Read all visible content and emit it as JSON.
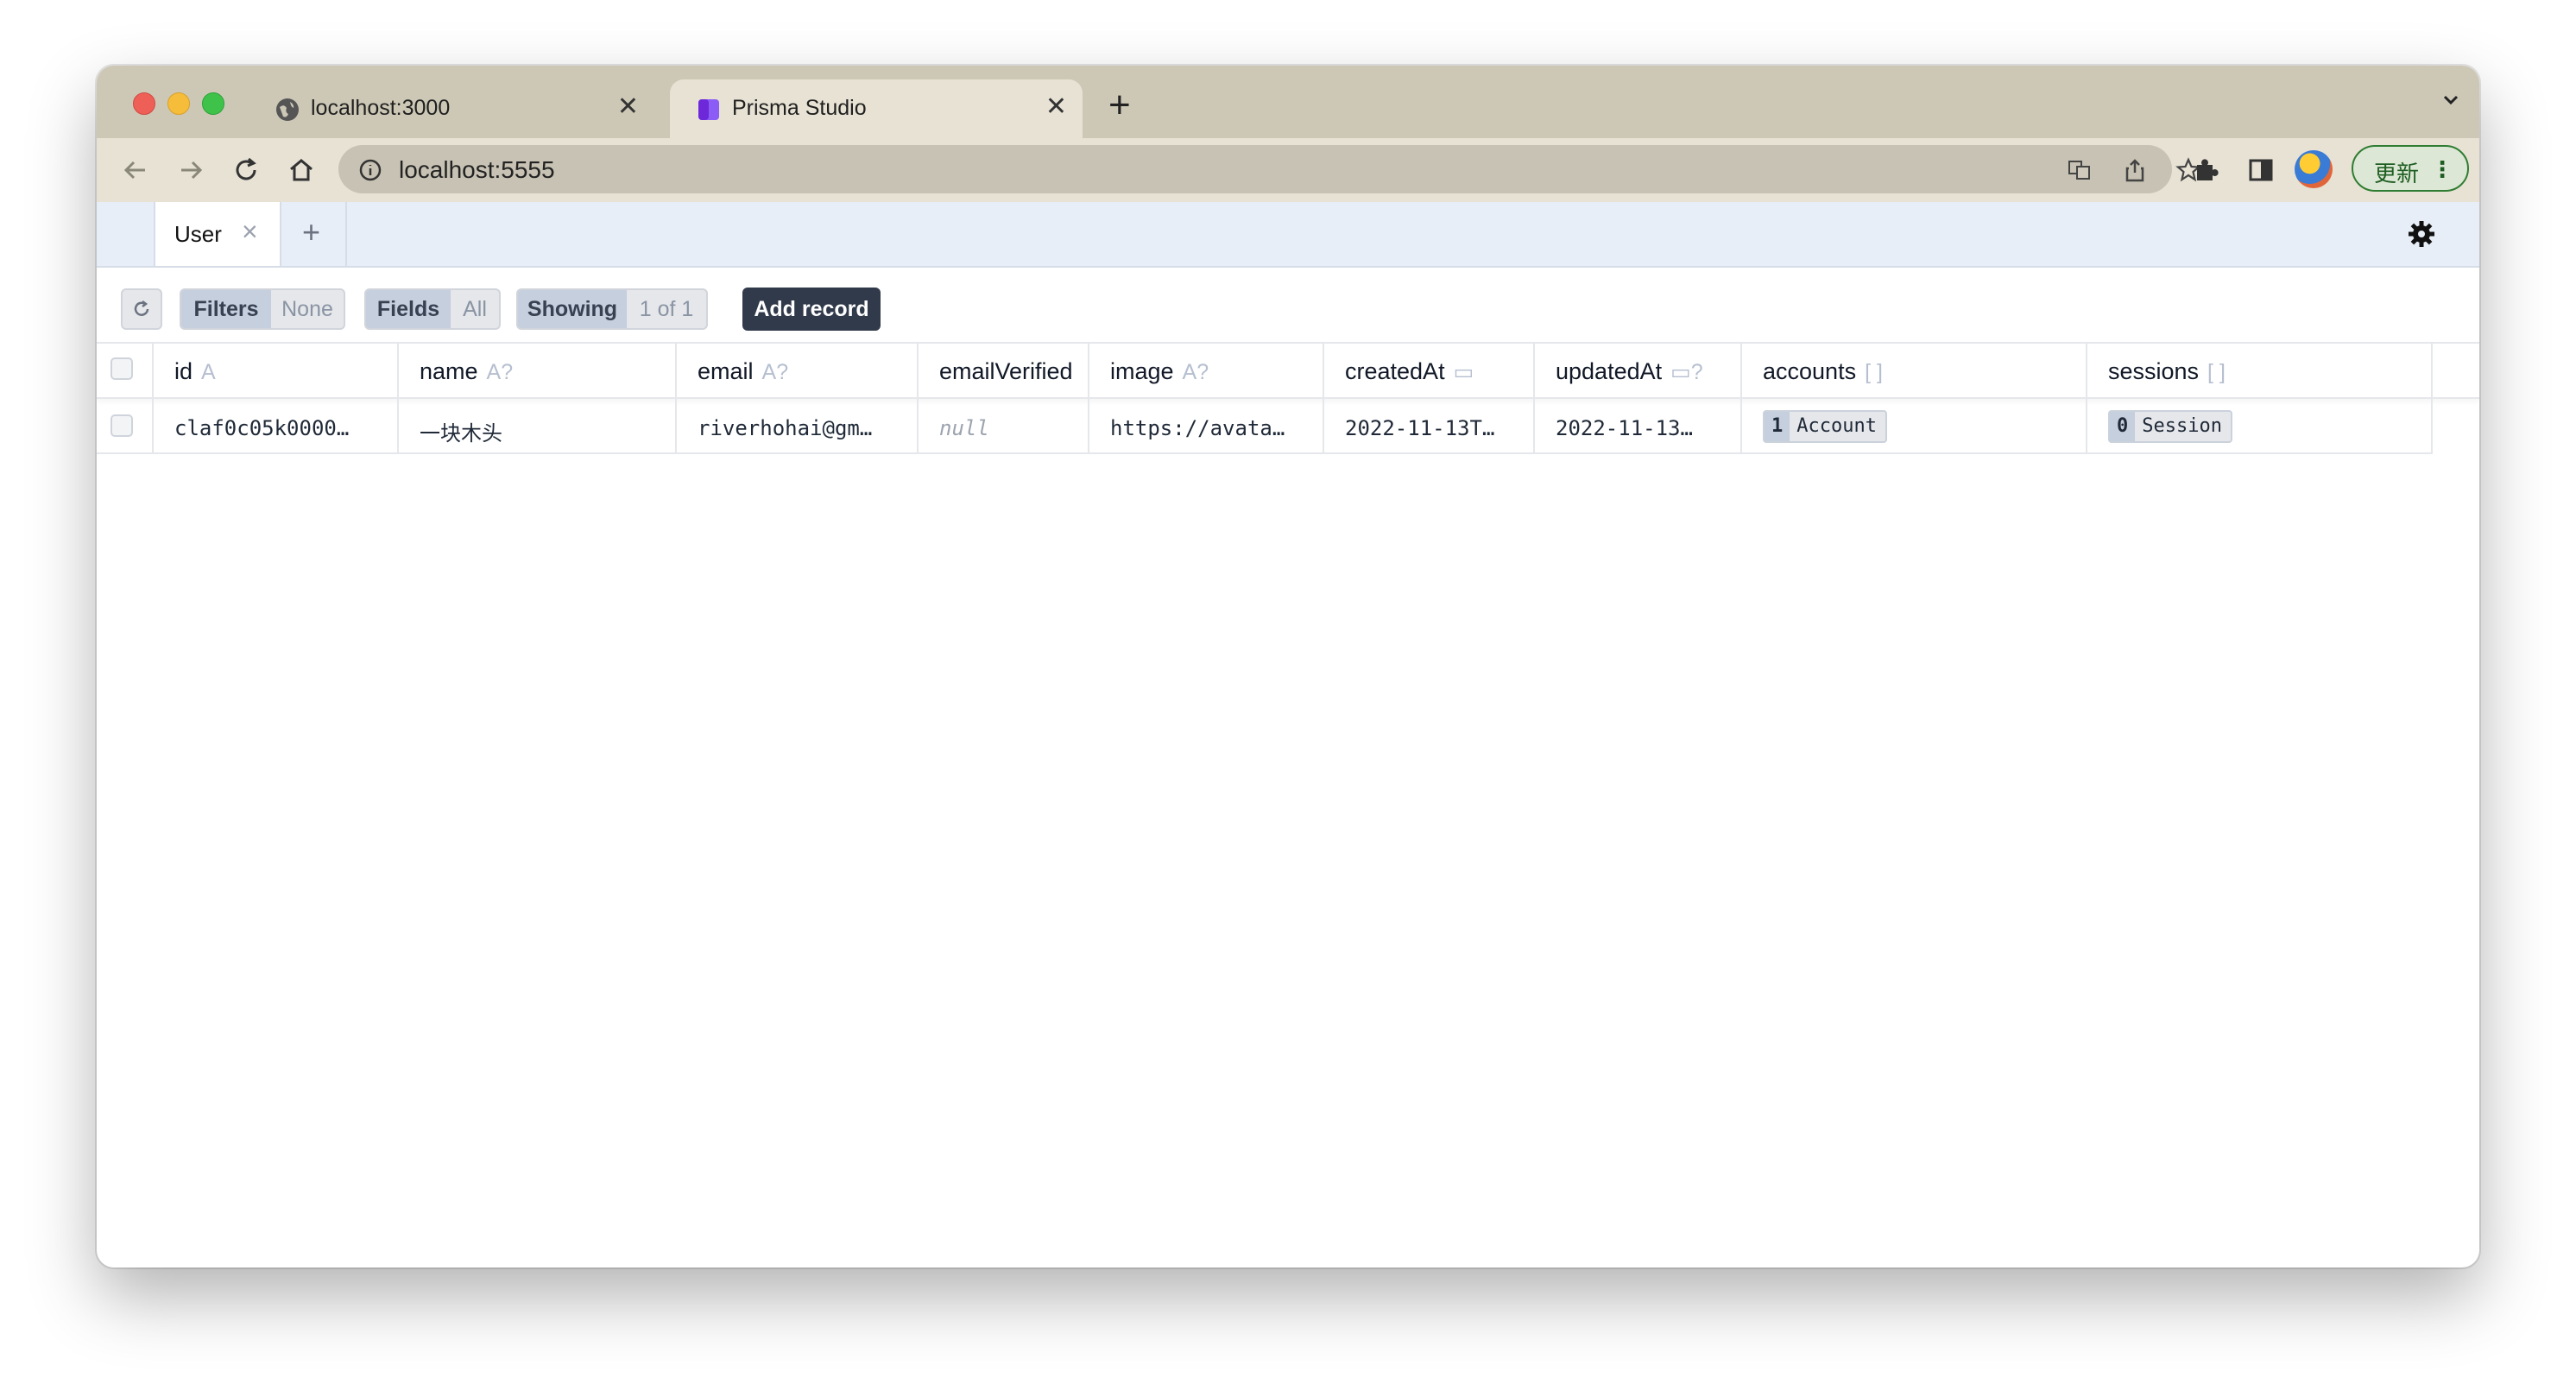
{
  "browser": {
    "tabs": [
      {
        "title": "localhost:3000",
        "icon": "globe-icon"
      },
      {
        "title": "Prisma Studio",
        "icon": "prisma-icon",
        "active": true
      }
    ],
    "new_tab_label": "+",
    "url": "localhost:5555",
    "update_label": "更新"
  },
  "studio": {
    "model_tab": "User",
    "add_tab_label": "+",
    "toolbar": {
      "filters_label": "Filters",
      "filters_value": "None",
      "fields_label": "Fields",
      "fields_value": "All",
      "showing_label": "Showing",
      "showing_value": "1 of 1",
      "add_record_label": "Add record"
    },
    "columns": [
      {
        "name": "id",
        "type": "A"
      },
      {
        "name": "name",
        "type": "A?"
      },
      {
        "name": "email",
        "type": "A?"
      },
      {
        "name": "emailVerified",
        "type": ""
      },
      {
        "name": "image",
        "type": "A?"
      },
      {
        "name": "createdAt",
        "type": "▭"
      },
      {
        "name": "updatedAt",
        "type": "▭?"
      },
      {
        "name": "accounts",
        "type": "[ ]"
      },
      {
        "name": "sessions",
        "type": "[ ]"
      }
    ],
    "rows": [
      {
        "id": "claf0c05k0000…",
        "name": "一块木头",
        "email": "riverhohai@gm…",
        "emailVerified": "null",
        "image": "https://avata…",
        "createdAt": "2022-11-13T…",
        "updatedAt": "2022-11-13…",
        "accounts_count": "1",
        "accounts_label": "Account",
        "sessions_count": "0",
        "sessions_label": "Session"
      }
    ]
  }
}
